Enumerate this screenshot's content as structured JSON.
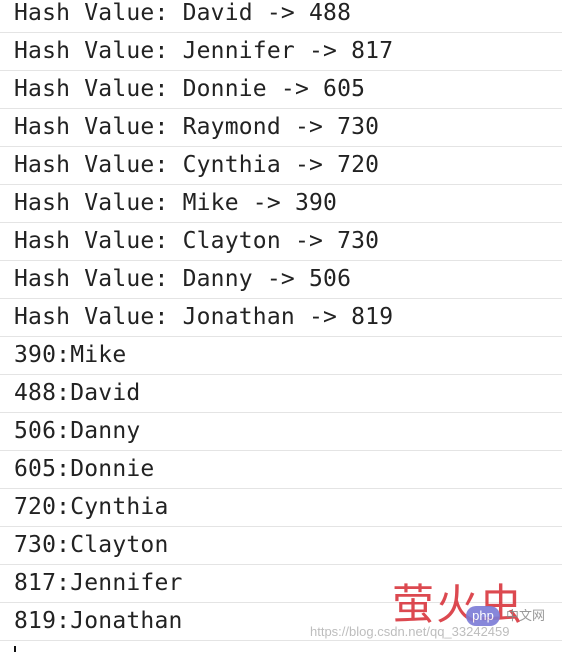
{
  "console": {
    "lines": [
      "Hash Value: David -> 488",
      "Hash Value: Jennifer -> 817",
      "Hash Value: Donnie -> 605",
      "Hash Value: Raymond -> 730",
      "Hash Value: Cynthia -> 720",
      "Hash Value: Mike -> 390",
      "Hash Value: Clayton -> 730",
      "Hash Value: Danny -> 506",
      "Hash Value: Jonathan -> 819",
      "390:Mike",
      "488:David",
      "506:Danny",
      "605:Donnie",
      "720:Cynthia",
      "730:Clayton",
      "817:Jennifer",
      "819:Jonathan"
    ]
  },
  "watermark": {
    "logo_text": "萤火虫",
    "badge_text": "php",
    "cn_text": "中文网",
    "url_text": "https://blog.csdn.net/qq_33242459"
  },
  "colors": {
    "text": "#222222",
    "divider": "#e4e4e4",
    "watermark_logo": "#d9363e",
    "watermark_badge": "#7b7bd6"
  }
}
